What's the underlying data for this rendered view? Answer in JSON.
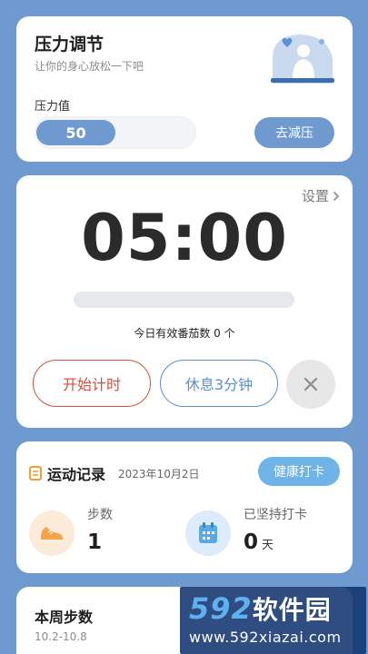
{
  "stress": {
    "title": "压力调节",
    "subtitle": "让你的身心放松一下吧",
    "label": "压力值",
    "value": "50",
    "level_fraction": 0.5,
    "action": "去减压"
  },
  "timer": {
    "settings": "设置",
    "time": "05:00",
    "progress_fraction": 0,
    "count_text": "今日有效番茄数 0 个",
    "start_button": "开始计时",
    "rest_button": "休息3分钟"
  },
  "exercise": {
    "title": "运动记录",
    "date": "2023年10月2日",
    "checkin_button": "健康打卡",
    "steps_label": "步数",
    "steps_value": "1",
    "streak_label": "已坚持打卡",
    "streak_value": "0",
    "streak_unit": "天"
  },
  "week": {
    "title": "本周步数",
    "range": "10.2-10.8"
  },
  "watermark": {
    "logo_number": "592",
    "logo_text": "软件园",
    "url": "www.592xiazai.com"
  },
  "colors": {
    "background": "#6f9ad0",
    "accent": "#6f9ad0",
    "start_red": "#d94e3e",
    "rest_blue": "#5b8fd6",
    "checkin_blue": "#6fb4e8"
  }
}
